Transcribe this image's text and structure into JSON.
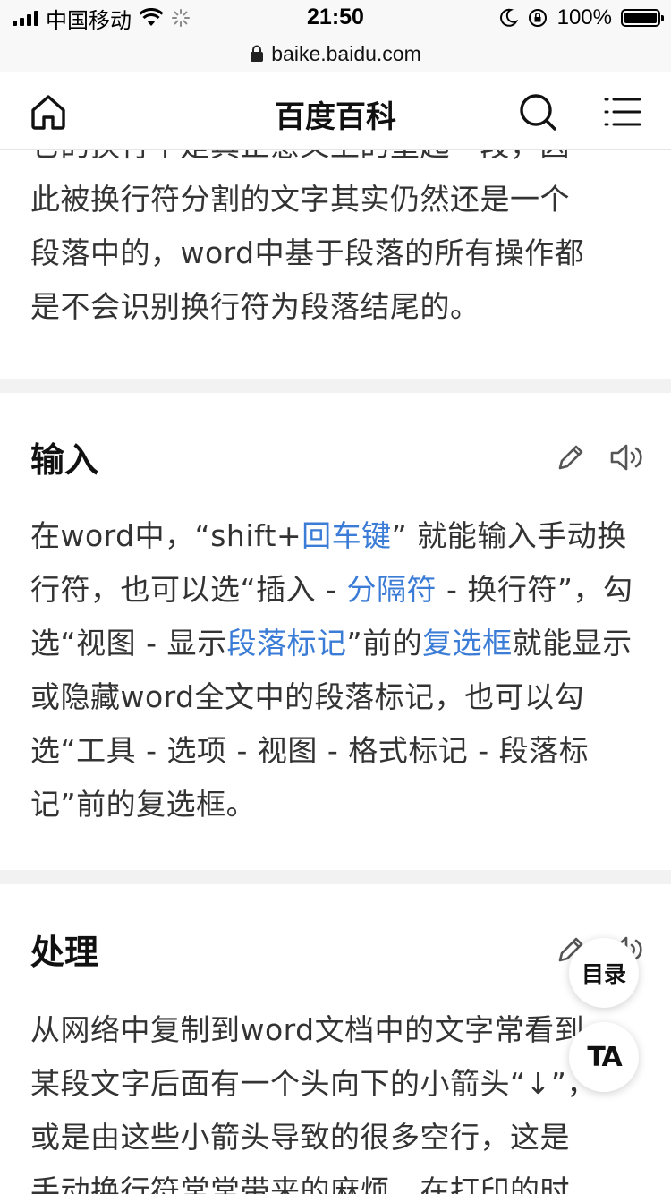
{
  "status_bar": {
    "carrier": "中国移动",
    "time": "21:50",
    "battery_percent": "100%",
    "battery_level": 1.0
  },
  "url_bar": {
    "domain": "baike.baidu.com"
  },
  "header": {
    "title": "百度百科"
  },
  "article": {
    "intro_lines": [
      "它的换行不是真正意义上的重起一段，因",
      "此被换行符分割的文字其实仍然还是一个",
      "段落中的，word中基于段落的所有操作都",
      "是不会识别换行符为段落结尾的。"
    ],
    "sections": [
      {
        "title": "输入",
        "paragraph": {
          "t1": "在word中，“shift+",
          "l1": "回车键",
          "t2": "” 就能输入手动换行符，也可以选“插入 - ",
          "l2": "分隔符",
          "t3": " - 换行符”，勾选“视图 - 显示",
          "l3": "段落标记",
          "t4": "”前的",
          "l4": "复选框",
          "t5": "就能显示或隐藏word全文中的段落标记，也可以勾选“工具 - 选项 - 视图 - 格式标记 - 段落标记”前的复选框。"
        }
      },
      {
        "title": "处理",
        "lines": [
          "从网络中复制到word文档中的文字常看到",
          "某段文字后面有一个头向下的小箭头“↓”，",
          "或是由这些小箭头导致的很多空行，这是",
          "手动换行符常常带来的麻烦，在打印的时"
        ]
      }
    ]
  },
  "floating": {
    "toc_label": "目录",
    "ta_label": "TA"
  },
  "colors": {
    "link": "#3b7cd6",
    "separator": "#f2f2f2"
  }
}
